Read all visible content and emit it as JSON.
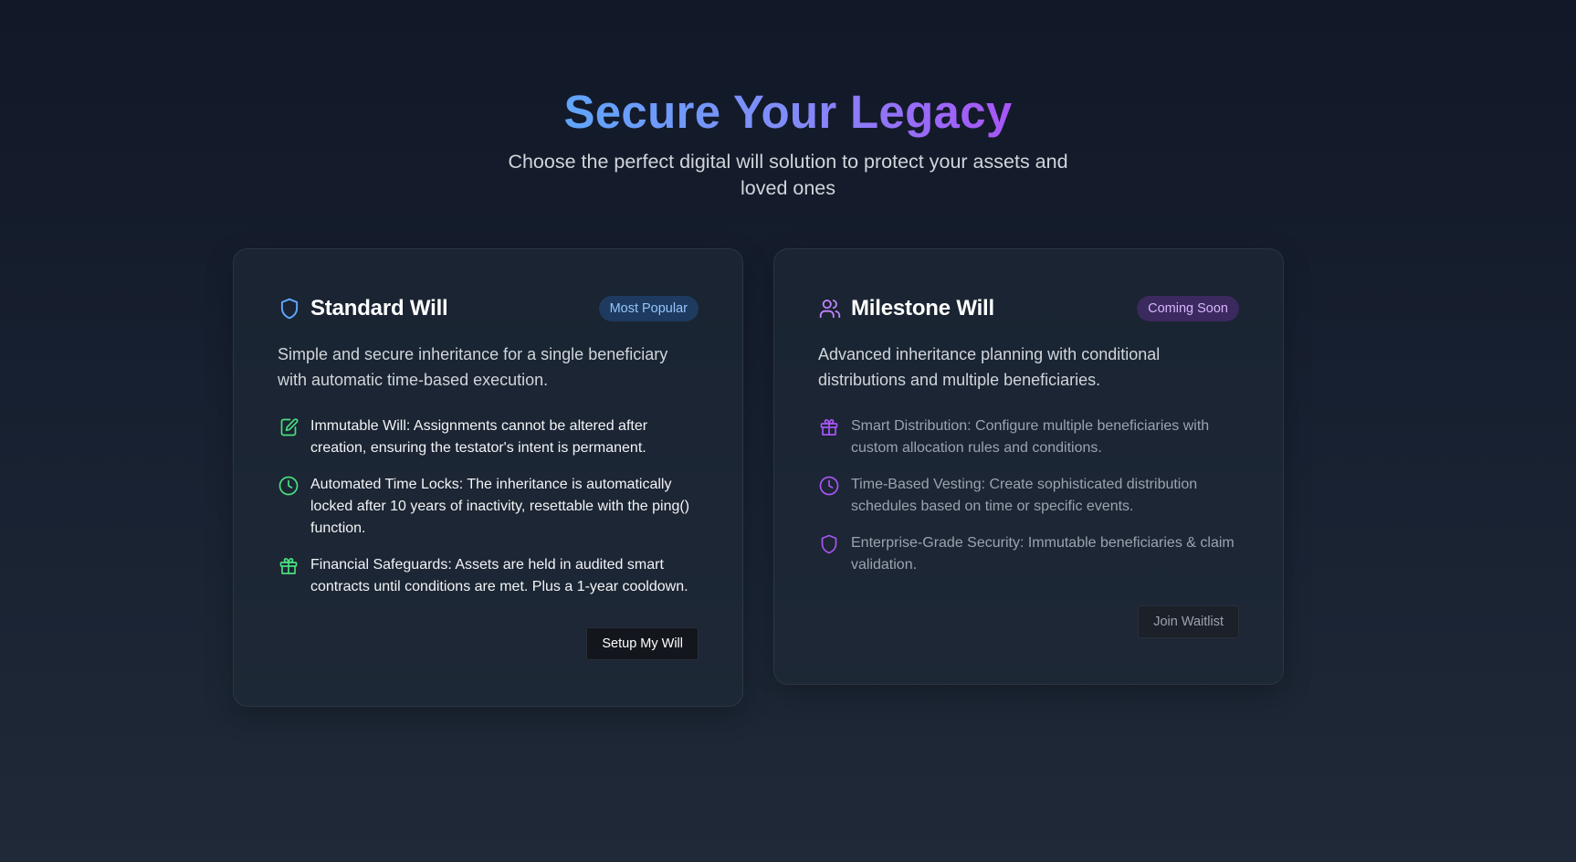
{
  "hero": {
    "title": "Secure Your Legacy",
    "subtitle": "Choose the perfect digital will solution to protect your assets and loved ones"
  },
  "cards": [
    {
      "title": "Standard Will",
      "icon": "shield-icon",
      "badge": "Most Popular",
      "description": "Simple and secure inheritance for a single beneficiary with automatic time-based execution.",
      "accent": "#4ade80",
      "features": [
        {
          "icon": "document-edit-icon",
          "text": "Immutable Will: Assignments cannot be altered after creation, ensuring the testator's intent is permanent."
        },
        {
          "icon": "clock-icon",
          "text": "Automated Time Locks: The inheritance is automatically locked after 10 years of inactivity, resettable with the ping() function."
        },
        {
          "icon": "gift-icon",
          "text": "Financial Safeguards: Assets are held in audited smart contracts until conditions are met. Plus a 1-year cooldown."
        }
      ],
      "button": "Setup My Will"
    },
    {
      "title": "Milestone Will",
      "icon": "users-icon",
      "badge": "Coming Soon",
      "description": "Advanced inheritance planning with conditional distributions and multiple beneficiaries.",
      "accent": "#a855f7",
      "features": [
        {
          "icon": "gift-icon",
          "text": "Smart Distribution: Configure multiple beneficiaries with custom allocation rules and conditions."
        },
        {
          "icon": "clock-icon",
          "text": "Time-Based Vesting: Create sophisticated distribution schedules based on time or specific events."
        },
        {
          "icon": "shield-icon",
          "text": "Enterprise-Grade Security: Immutable beneficiaries & claim validation."
        }
      ],
      "button": "Join Waitlist"
    }
  ],
  "colors": {
    "shield_blue": "#60a5fa",
    "feature_green": "#4ade80",
    "feature_purple": "#a855f7"
  }
}
